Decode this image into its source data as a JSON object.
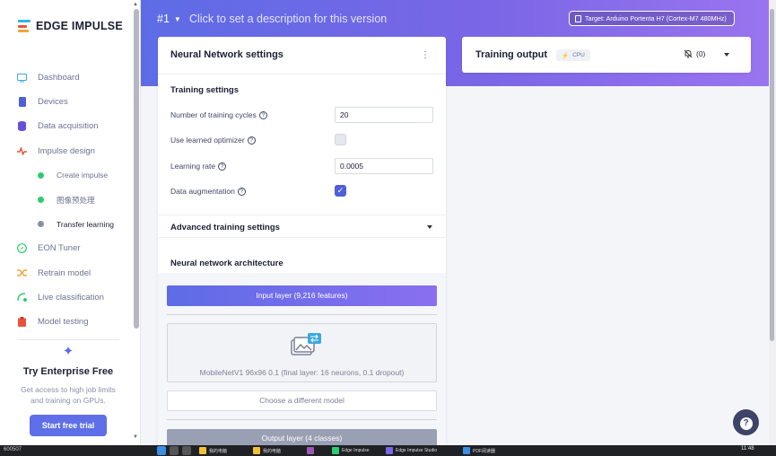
{
  "sidebar": {
    "logo_text": "EDGE IMPULSE",
    "logo_colors": [
      "#33b6e6",
      "#e8543a",
      "#f1a43c"
    ],
    "items": [
      {
        "label": "Dashboard",
        "icon": "monitor-icon",
        "color": "#3aa8e0"
      },
      {
        "label": "Devices",
        "icon": "device-icon",
        "color": "#4f5fd8"
      },
      {
        "label": "Data acquisition",
        "icon": "database-icon",
        "color": "#6a4fd8"
      },
      {
        "label": "Impulse design",
        "icon": "pulse-icon",
        "color": "#e8543a"
      }
    ],
    "subitems": [
      {
        "label": "Create impulse",
        "dot": "#2ecc71"
      },
      {
        "label": "图像预处理",
        "dot": "#2ecc71"
      },
      {
        "label": "Transfer learning",
        "dot": "#8a8fa8"
      }
    ],
    "items2": [
      {
        "label": "EON Tuner",
        "icon": "compass-icon",
        "color": "#2ecc71"
      },
      {
        "label": "Retrain model",
        "icon": "shuffle-icon",
        "color": "#f1a43c"
      },
      {
        "label": "Live classification",
        "icon": "live-icon",
        "color": "#2ecc71"
      },
      {
        "label": "Model testing",
        "icon": "clipboard-icon",
        "color": "#e8543a"
      }
    ],
    "enterprise": {
      "title": "Try Enterprise Free",
      "desc": "Get access to high job limits and training on GPUs.",
      "button": "Start free trial"
    }
  },
  "header": {
    "version": "#1",
    "description_placeholder": "Click to set a description for this version",
    "target": "Target: Arduino Portenta H7 (Cortex-M7 480MHz)"
  },
  "nn": {
    "title": "Neural Network settings",
    "training_settings": "Training settings",
    "cycles_label": "Number of training cycles",
    "cycles_value": "20",
    "optimizer_label": "Use learned optimizer",
    "optimizer_checked": false,
    "lr_label": "Learning rate",
    "lr_value": "0.0005",
    "aug_label": "Data augmentation",
    "aug_checked": true,
    "advanced": "Advanced training settings",
    "architecture": "Neural network architecture",
    "input_layer": "Input layer (9,216 features)",
    "model_text": "MobileNetV1 96x96 0.1 (final layer: 16 neurons, 0.1 dropout)",
    "choose_model": "Choose a different model",
    "output_layer": "Output layer (4 classes)"
  },
  "training_output": {
    "title": "Training output",
    "cpu_badge": "CPU",
    "notif_count": "(0)"
  },
  "help_label": "?",
  "taskbar": {
    "left_text": "600507",
    "time": "11:48",
    "apps": [
      "我的电脑",
      "我的电脑",
      "",
      "Edge Impulse",
      "Edge Impulse Studio",
      "PDF阅读器"
    ]
  }
}
